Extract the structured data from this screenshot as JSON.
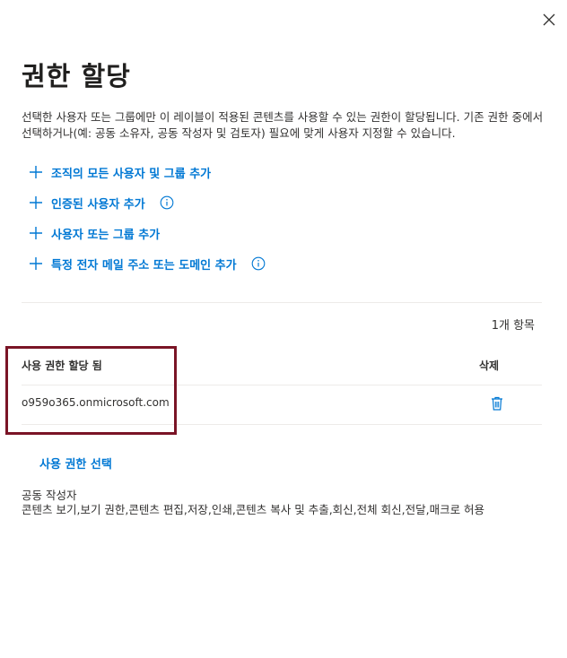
{
  "dialog": {
    "close_icon": "close-icon",
    "title": "권한 할당",
    "description": "선택한 사용자 또는 그룹에만 이 레이블이 적용된 콘텐츠를 사용할 수 있는 권한이 할당됩니다. 기존 권한 중에서 선택하거나(예: 공동 소유자, 공동 작성자 및 검토자) 필요에 맞게 사용자 지정할 수 있습니다."
  },
  "actions": [
    {
      "label": "조직의 모든 사용자 및 그룹 추가",
      "icon": "plus-icon",
      "has_info": false
    },
    {
      "label": "인증된 사용자 추가",
      "icon": "plus-icon",
      "has_info": true
    },
    {
      "label": "사용자 또는 그룹 추가",
      "icon": "plus-icon",
      "has_info": false
    },
    {
      "label": "특정 전자 메일 주소 또는 도메인 추가",
      "icon": "plus-icon",
      "has_info": true
    }
  ],
  "table": {
    "item_count": "1개 항목",
    "columns": {
      "assigned": "사용 권한 할당 됨",
      "delete": "삭제"
    },
    "rows": [
      {
        "user": "o959o365.onmicrosoft.com",
        "delete_icon": "trash-icon"
      }
    ]
  },
  "permissions": {
    "choose_label": "사용 권한 선택",
    "preset_name": "공동 작성자",
    "rights": "콘텐츠 보기,보기 권한,콘텐츠 편집,저장,인쇄,콘텐츠 복사 및 추출,회신,전체 회신,전달,매크로 허용"
  },
  "colors": {
    "accent": "#0078d4",
    "highlight_border": "#7a1426",
    "text": "#323130",
    "divider": "#edebe9"
  }
}
